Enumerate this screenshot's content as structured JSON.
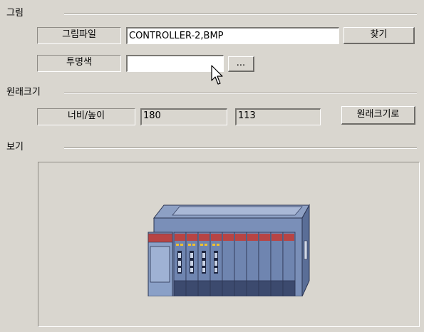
{
  "picture_group": {
    "title": "그림",
    "file_label": "그림파일",
    "file_value": "CONTROLLER-2,BMP",
    "find_button": "찾기",
    "transparent_label": "투명색",
    "transparent_value": "",
    "ellipsis_button": "..."
  },
  "original_size_group": {
    "title": "원래크기",
    "size_label": "너비/높이",
    "width": "180",
    "height": "113",
    "reset_button": "원래크기로"
  },
  "preview_group": {
    "title": "보기",
    "image": "plc-controller-rack"
  },
  "colors": {
    "background": "#d9d6cf",
    "module_face": "#6f85b0",
    "module_stripe": "#b74444",
    "led": "#f2c12e"
  }
}
